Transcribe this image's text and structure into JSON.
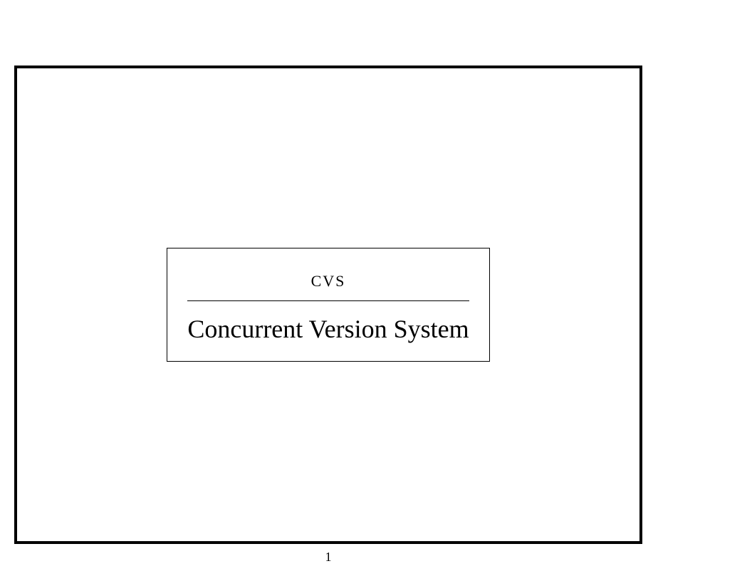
{
  "slide": {
    "title_abbrev": "cvs",
    "title_full": "Concurrent Version System"
  },
  "page_number": "1"
}
